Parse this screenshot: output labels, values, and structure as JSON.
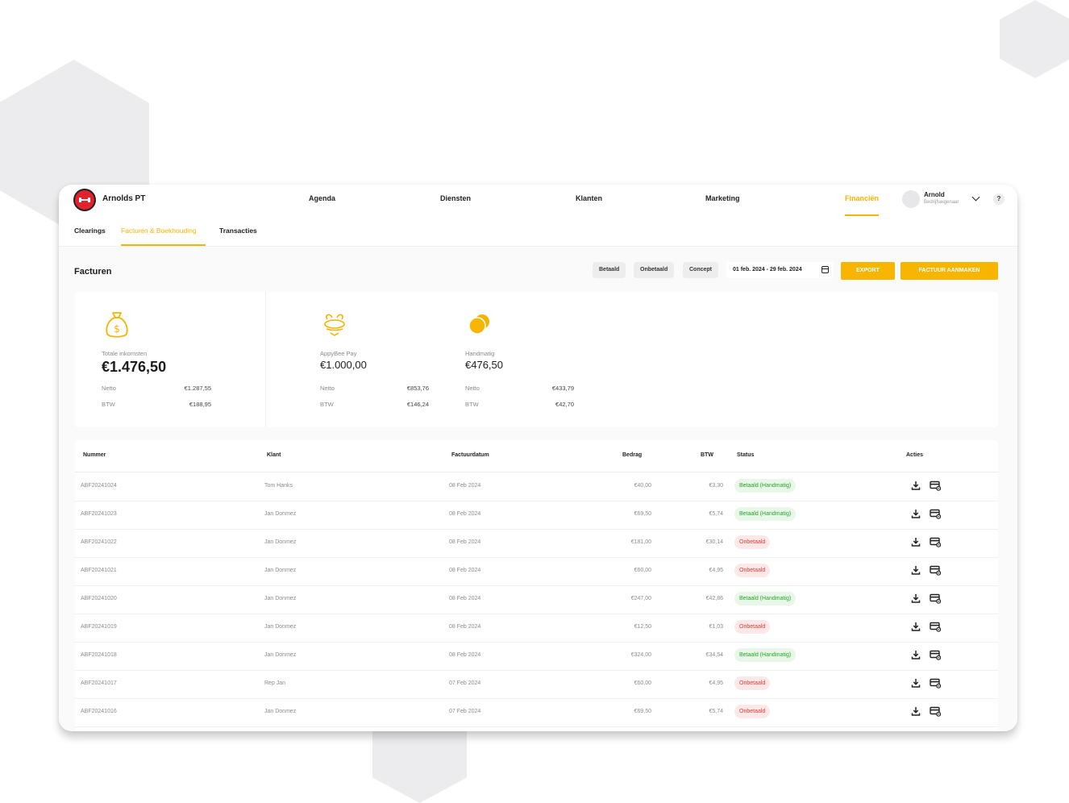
{
  "app": {
    "name": "Arnolds PT"
  },
  "nav": [
    {
      "label": "Agenda"
    },
    {
      "label": "Diensten"
    },
    {
      "label": "Klanten"
    },
    {
      "label": "Marketing"
    },
    {
      "label": "Financiën"
    }
  ],
  "user": {
    "name": "Arnold",
    "role": "Bedrijfseigenaar"
  },
  "help": "?",
  "subnav": [
    {
      "label": "Clearings"
    },
    {
      "label": "Facturen & Boekhouding"
    },
    {
      "label": "Transacties"
    }
  ],
  "page": {
    "title": "Facturen"
  },
  "filters": [
    "Betaald",
    "Onbetaald",
    "Concept"
  ],
  "date_range": "01 feb. 2024 - 29 feb. 2024",
  "actions": {
    "export": "EXPORT",
    "create": "FACTUUR AANMAKEN"
  },
  "stats": {
    "total": {
      "label": "Totale inkomsten",
      "value": "€1.476,50",
      "netto_label": "Netto",
      "netto": "€1.287,55",
      "btw_label": "BTW",
      "btw": "€188,95"
    },
    "appybee": {
      "label": "AppyBee Pay",
      "value": "€1.000,00",
      "netto_label": "Netto",
      "netto": "€853,76",
      "btw_label": "BTW",
      "btw": "€146,24"
    },
    "manual": {
      "label": "Handmatig",
      "value": "€476,50",
      "netto_label": "Netto",
      "netto": "€433,79",
      "btw_label": "BTW",
      "btw": "€42,70"
    }
  },
  "table": {
    "headers": {
      "nummer": "Nummer",
      "klant": "Klant",
      "datum": "Factuurdatum",
      "bedrag": "Bedrag",
      "btw": "BTW",
      "status": "Status",
      "acties": "Acties"
    },
    "rows": [
      {
        "nummer": "ABF20241024",
        "klant": "Tom Hanks",
        "datum": "08 Feb 2024",
        "bedrag": "€40,00",
        "btw": "€3,30",
        "status": "Betaald (Handmatig)",
        "paid": true
      },
      {
        "nummer": "ABF20241023",
        "klant": "Jan Donmez",
        "datum": "08 Feb 2024",
        "bedrag": "€69,50",
        "btw": "€5,74",
        "status": "Betaald (Handmatig)",
        "paid": true
      },
      {
        "nummer": "ABF20241022",
        "klant": "Jan Donmez",
        "datum": "08 Feb 2024",
        "bedrag": "€181,00",
        "btw": "€30,14",
        "status": "Onbetaald",
        "paid": false
      },
      {
        "nummer": "ABF20241021",
        "klant": "Jan Donmez",
        "datum": "08 Feb 2024",
        "bedrag": "€60,00",
        "btw": "€4,95",
        "status": "Onbetaald",
        "paid": false
      },
      {
        "nummer": "ABF20241020",
        "klant": "Jan Donmez",
        "datum": "08 Feb 2024",
        "bedrag": "€247,00",
        "btw": "€42,86",
        "status": "Betaald (Handmatig)",
        "paid": true
      },
      {
        "nummer": "ABF20241019",
        "klant": "Jan Donmez",
        "datum": "08 Feb 2024",
        "bedrag": "€12,50",
        "btw": "€1,03",
        "status": "Onbetaald",
        "paid": false
      },
      {
        "nummer": "ABF20241018",
        "klant": "Jan Donmez",
        "datum": "08 Feb 2024",
        "bedrag": "€324,00",
        "btw": "€34,54",
        "status": "Betaald (Handmatig)",
        "paid": true
      },
      {
        "nummer": "ABF20241017",
        "klant": "Rep Jan",
        "datum": "07 Feb 2024",
        "bedrag": "€60,00",
        "btw": "€4,95",
        "status": "Onbetaald",
        "paid": false
      },
      {
        "nummer": "ABF20241016",
        "klant": "Jan Donmez",
        "datum": "07 Feb 2024",
        "bedrag": "€69,50",
        "btw": "€5,74",
        "status": "Onbetaald",
        "paid": false
      }
    ]
  },
  "colors": {
    "accent": "#f5b400",
    "paid": "#27a52b",
    "unpaid": "#e53935",
    "logo": "#e1212b"
  },
  "icons": {
    "logo": "dumbbell-logo-icon",
    "money_bag": "money-bag-icon",
    "bee": "bee-icon",
    "coins": "coins-icon",
    "calendar": "calendar-icon",
    "download": "download-icon",
    "card": "credit-card-icon",
    "chevron": "chevron-down-icon"
  }
}
